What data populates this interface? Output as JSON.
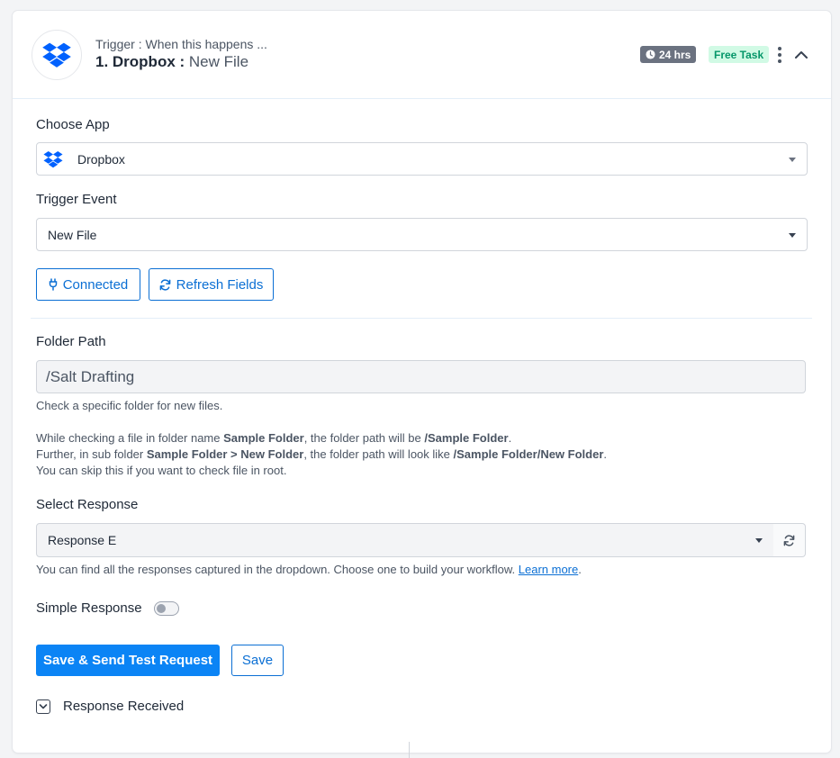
{
  "header": {
    "subtitle": "Trigger : When this happens ...",
    "step_app": "1. Dropbox :",
    "step_event": "New File",
    "time_badge": "24 hrs",
    "task_badge": "Free Task"
  },
  "choose_app": {
    "label": "Choose App",
    "value": "Dropbox"
  },
  "trigger_event": {
    "label": "Trigger Event",
    "value": "New File"
  },
  "buttons": {
    "connected": "Connected",
    "refresh_fields": "Refresh Fields"
  },
  "folder_path": {
    "label": "Folder Path",
    "value": "/Salt Drafting",
    "help1": "Check a specific folder for new files.",
    "help2_a": "While checking a file in folder name ",
    "help2_b": "Sample Folder",
    "help2_c": ", the folder path will be ",
    "help2_d": "/Sample Folder",
    "help2_e": ".",
    "help3_a": "Further, in sub folder ",
    "help3_b": "Sample Folder > New Folder",
    "help3_c": ", the folder path will look like ",
    "help3_d": "/Sample Folder/New Folder",
    "help3_e": ".",
    "help4": "You can skip this if you want to check file in root."
  },
  "select_response": {
    "label": "Select Response",
    "value": "Response E",
    "help": "You can find all the responses captured in the dropdown. Choose one to build your workflow. ",
    "learn_more": "Learn more",
    "help_end": "."
  },
  "simple_response": {
    "label": "Simple Response",
    "enabled": false
  },
  "actions": {
    "save_send": "Save & Send Test Request",
    "save": "Save"
  },
  "response_received": {
    "label": "Response Received"
  },
  "colors": {
    "primary": "#0b84f5",
    "link": "#0b6fd4",
    "dropbox": "#0061fe",
    "free_task_bg": "#d1fae5",
    "free_task_text": "#059669"
  }
}
